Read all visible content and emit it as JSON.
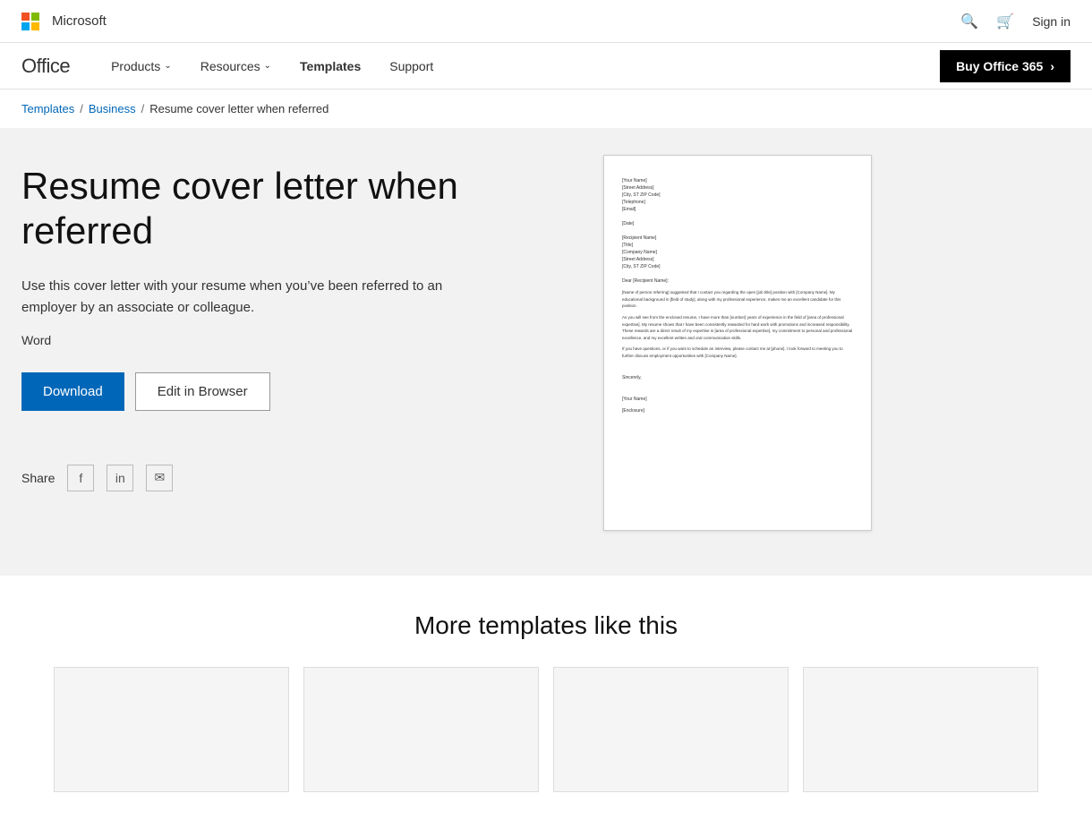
{
  "ms_logo_text": "Microsoft",
  "nav": {
    "office": "Office",
    "products": "Products",
    "resources": "Resources",
    "templates": "Templates",
    "support": "Support",
    "buy_btn": "Buy Office 365"
  },
  "breadcrumb": {
    "templates": "Templates",
    "business": "Business",
    "current": "Resume cover letter when referred"
  },
  "template": {
    "title": "Resume cover letter when referred",
    "description": "Use this cover letter with your resume when you’ve been referred to an employer by an associate or colleague.",
    "type": "Word",
    "download_btn": "Download",
    "edit_btn": "Edit in Browser",
    "share_label": "Share"
  },
  "more_section": {
    "title": "More templates like this"
  },
  "doc_preview": {
    "line1": "[Your Name]",
    "line2": "[Street Address]",
    "line3": "[City, ST ZIP Code]",
    "line4": "[Telephone]",
    "line5": "[Email]",
    "line6": "[Date]",
    "line7": "[Recipient Name]",
    "line8": "[Title]",
    "line9": "[Company Name]",
    "line10": "[Street Address]",
    "line11": "[City, ST ZIP Code]",
    "greeting": "Dear [Recipient Name]:",
    "para1": "[Name of person referring] suggested that I contact you regarding the open [job title] position with [Company Name]. My educational background in [field of study], along with my professional experience, makes me an excellent candidate for this position.",
    "para2": "As you will see from the enclosed resume, I have more than [number] years of experience in the field of [area of professional expertise]. My resume shows that I have been consistently rewarded for hard work with promotions and increased responsibility. These rewards are a direct result of my expertise in [area of professional expertise], my commitment to personal and professional excellence, and my excellent written and oral communication skills.",
    "para3": "If you have questions, or if you want to schedule an interview, please contact me at [phone]. I look forward to meeting you to further discuss employment opportunities with [Company Name].",
    "closing": "Sincerely,",
    "name": "[Your Name]",
    "enclosure": "[Enclosure]"
  }
}
